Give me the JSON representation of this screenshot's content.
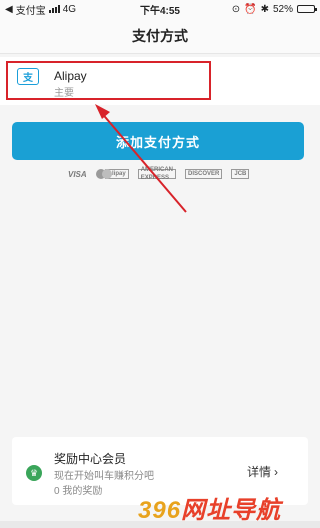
{
  "status_bar": {
    "carrier": "支付宝",
    "network": "4G",
    "time": "下午4:55",
    "battery": "52%",
    "battery_level": 0.52
  },
  "nav": {
    "title": "支付方式"
  },
  "payment_method": {
    "name": "Alipay",
    "subtitle": "主要",
    "logo_glyph": "支"
  },
  "add_button": {
    "label": "添加支付方式"
  },
  "card_brands": [
    "VISA",
    "Alipay",
    "AMERICAN EXPRESS",
    "DISCOVER",
    "JCB"
  ],
  "rewards": {
    "title": "奖励中心会员",
    "description": "现在开始叫车赚积分吧",
    "count": "0 我的奖励",
    "details": "详情"
  },
  "watermark": {
    "part1": "396",
    "part2": "网址导航"
  },
  "colors": {
    "accent": "#1aa0d4",
    "highlight": "#d8232a",
    "reward_green": "#3aa55a"
  }
}
